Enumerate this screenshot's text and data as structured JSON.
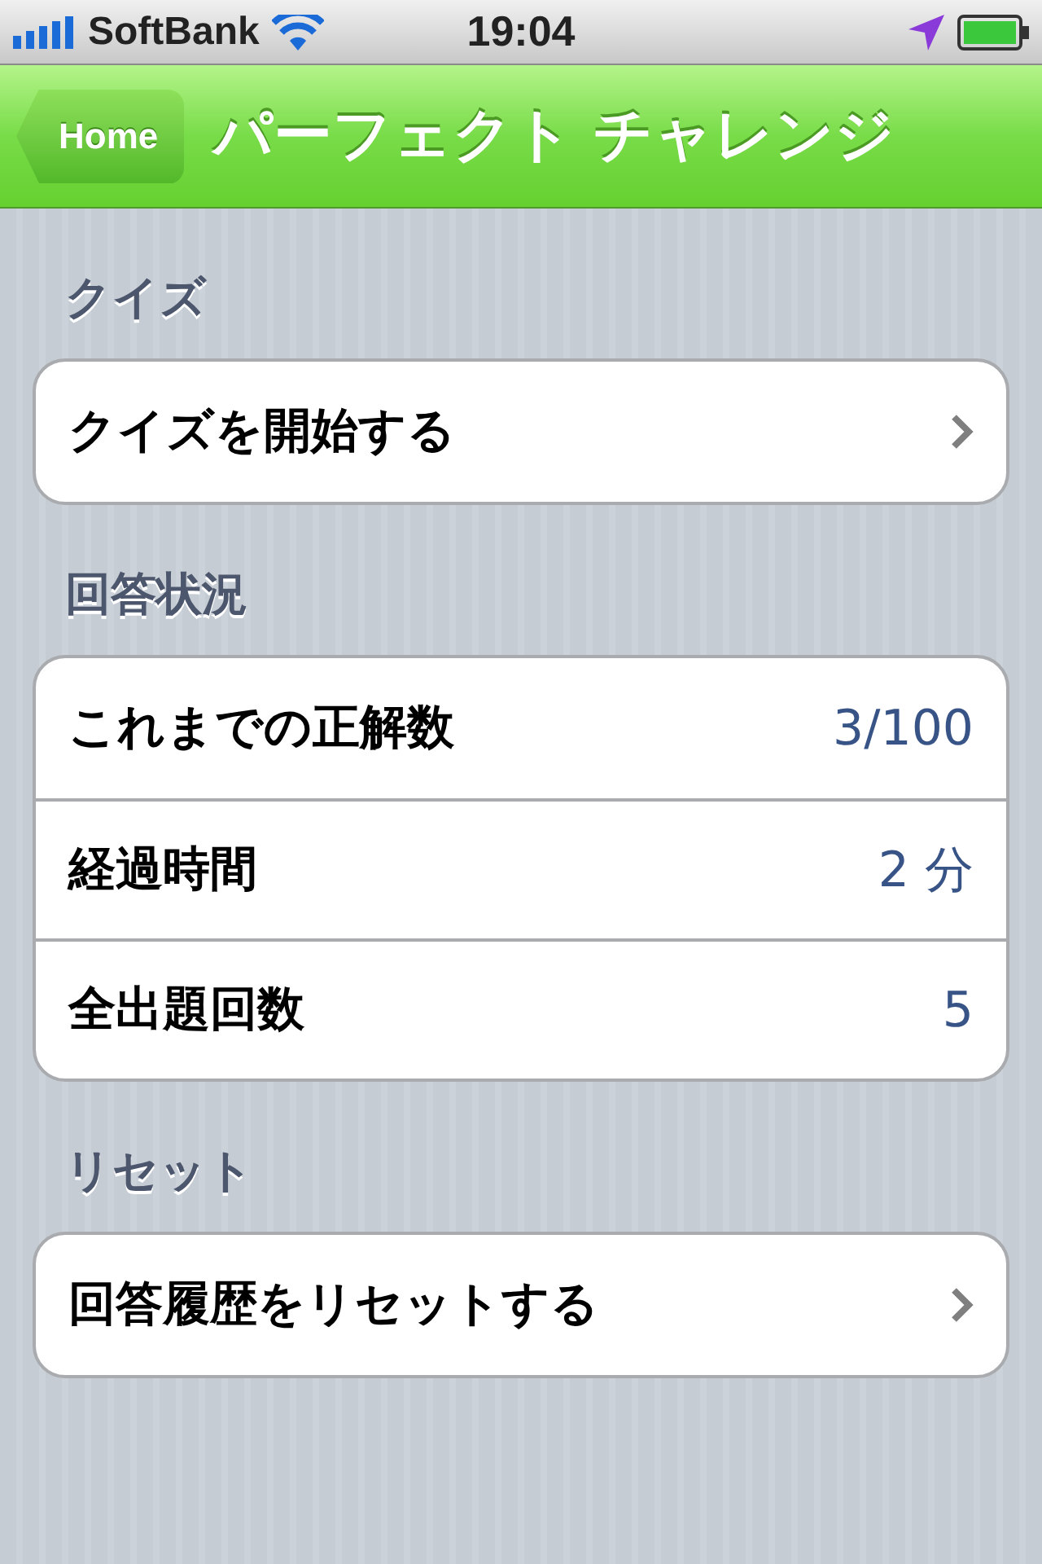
{
  "status_bar": {
    "carrier": "SoftBank",
    "time": "19:04"
  },
  "nav_bar": {
    "back_button": "Home",
    "title": "パーフェクト チャレンジ"
  },
  "sections": [
    {
      "header": "クイズ",
      "rows": [
        {
          "kind": "link",
          "label": "クイズを開始する"
        }
      ]
    },
    {
      "header": "回答状況",
      "rows": [
        {
          "kind": "value",
          "label": "これまでの正解数",
          "value": "3/100"
        },
        {
          "kind": "value",
          "label": "経過時間",
          "value": "2 分"
        },
        {
          "kind": "value",
          "label": "全出題回数",
          "value": "5"
        }
      ]
    },
    {
      "header": "リセット",
      "rows": [
        {
          "kind": "link",
          "label": "回答履歴をリセットする"
        }
      ]
    }
  ]
}
